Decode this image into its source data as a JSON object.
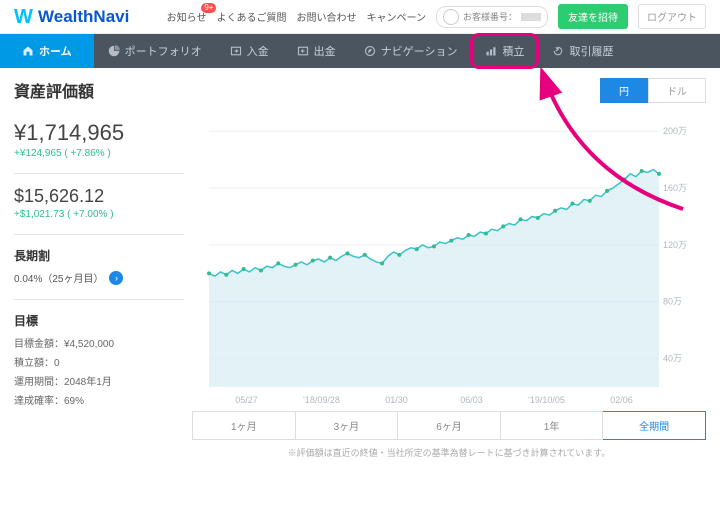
{
  "brand": "WealthNavi",
  "header": {
    "links": [
      "お知らせ",
      "よくあるご質問",
      "お問い合わせ",
      "キャンペーン"
    ],
    "notice_badge": "9+",
    "customer_label": "お客様番号：",
    "invite": "友達を招待",
    "logout": "ログアウト"
  },
  "nav": {
    "items": [
      {
        "icon": "home",
        "label": "ホーム"
      },
      {
        "icon": "pie",
        "label": "ポートフォリオ"
      },
      {
        "icon": "deposit",
        "label": "入金"
      },
      {
        "icon": "withdraw",
        "label": "出金"
      },
      {
        "icon": "compass",
        "label": "ナビゲーション"
      },
      {
        "icon": "bars",
        "label": "積立"
      },
      {
        "icon": "history",
        "label": "取引履歴"
      }
    ]
  },
  "page_title": "資産評価額",
  "valuation": {
    "jpy": "¥1,714,965",
    "jpy_delta": "+¥124,965",
    "jpy_pct": "( +7.86% )",
    "usd": "$15,626.12",
    "usd_delta": "+$1,021.73",
    "usd_pct": "( +7.00% )"
  },
  "longterm": {
    "title": "長期割",
    "rate": "0.04%（25ヶ月目）"
  },
  "goal": {
    "title": "目標",
    "amount_label": "目標金額：",
    "amount": "¥4,520,000",
    "monthly_label": "積立額：",
    "monthly": "0",
    "period_label": "運用期間：",
    "period": "2048年1月",
    "prob_label": "達成確率：",
    "prob": "69%"
  },
  "currency_tabs": {
    "yen": "円",
    "dollar": "ドル"
  },
  "range_tabs": [
    "1ヶ月",
    "3ヶ月",
    "6ヶ月",
    "1年",
    "全期間"
  ],
  "footnote": "※評価額は直近の終値・当社所定の基準為替レートに基づき計算されています。",
  "chart_data": {
    "type": "area",
    "x_labels": [
      "05/27",
      "'18/09/28",
      "01/30",
      "06/03",
      "'19/10/05",
      "02/06"
    ],
    "y_ticks": [
      40,
      80,
      120,
      160,
      200
    ],
    "y_suffix": "万",
    "ylim": [
      20,
      210
    ],
    "series": [
      {
        "name": "資産評価額",
        "values": [
          100,
          98,
          101,
          99,
          102,
          100,
          103,
          101,
          104,
          102,
          105,
          104,
          107,
          105,
          104,
          106,
          108,
          106,
          109,
          110,
          108,
          111,
          109,
          112,
          114,
          112,
          111,
          113,
          110,
          108,
          107,
          112,
          115,
          113,
          116,
          118,
          117,
          120,
          118,
          119,
          122,
          121,
          123,
          125,
          124,
          127,
          126,
          129,
          128,
          131,
          130,
          133,
          135,
          134,
          138,
          137,
          140,
          139,
          142,
          141,
          144,
          146,
          145,
          149,
          148,
          152,
          151,
          155,
          154,
          158,
          160,
          163,
          166,
          170,
          168,
          172,
          171,
          173,
          170
        ]
      }
    ]
  }
}
